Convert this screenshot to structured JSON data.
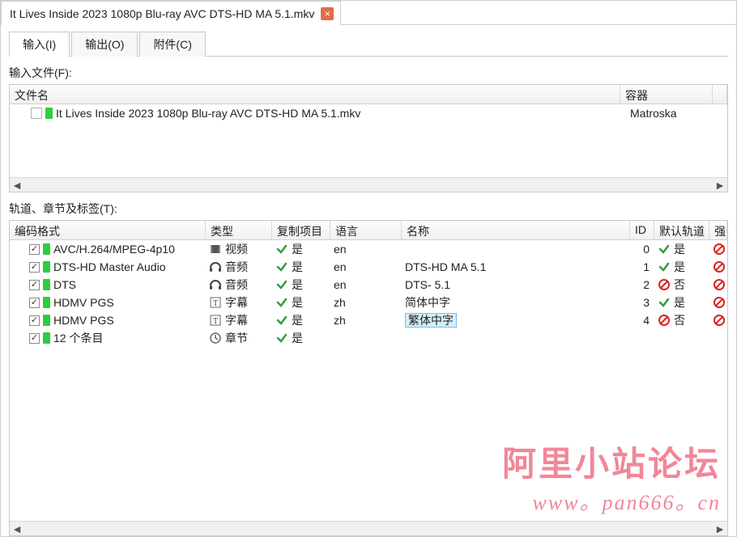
{
  "file_tab": {
    "title": "It Lives Inside 2023 1080p Blu-ray AVC DTS-HD MA 5.1.mkv"
  },
  "main_tabs": {
    "input": "输入(I)",
    "output": "输出(O)",
    "attachments": "附件(C)"
  },
  "input_files_label": "输入文件(F):",
  "files_header": {
    "name": "文件名",
    "container": "容器"
  },
  "file_row": {
    "name": "It Lives Inside 2023 1080p Blu-ray AVC DTS-HD MA 5.1.mkv",
    "container": "Matroska"
  },
  "tracks_label": "轨道、章节及标签(T):",
  "tracks_header": {
    "codec": "编码格式",
    "type": "类型",
    "copy": "复制项目",
    "lang": "语言",
    "name": "名称",
    "id": "ID",
    "default": "默认轨道",
    "forced_partial": "强"
  },
  "type_labels": {
    "video": "视频",
    "audio": "音频",
    "subtitle": "字幕",
    "chapter": "章节"
  },
  "yes": "是",
  "no": "否",
  "tracks": [
    {
      "checked": true,
      "swatch": "green",
      "codec": "AVC/H.264/MPEG-4p10",
      "type": "video",
      "copy": true,
      "lang": "en",
      "name": "",
      "id": "0",
      "default": true
    },
    {
      "checked": true,
      "swatch": "green",
      "codec": "DTS-HD Master Audio",
      "type": "audio",
      "copy": true,
      "lang": "en",
      "name": "DTS-HD MA 5.1",
      "id": "1",
      "default": true
    },
    {
      "checked": true,
      "swatch": "green",
      "codec": "DTS",
      "type": "audio",
      "copy": true,
      "lang": "en",
      "name": "DTS- 5.1",
      "id": "2",
      "default": false
    },
    {
      "checked": true,
      "swatch": "green",
      "codec": "HDMV PGS",
      "type": "subtitle",
      "copy": true,
      "lang": "zh",
      "name": "简体中字",
      "id": "3",
      "default": true
    },
    {
      "checked": true,
      "swatch": "green",
      "codec": "HDMV PGS",
      "type": "subtitle",
      "copy": true,
      "lang": "zh",
      "name": "繁体中字",
      "id": "4",
      "default": false,
      "selected": true
    },
    {
      "checked": true,
      "swatch": "green",
      "codec": "12 个条目",
      "type": "chapter",
      "copy": true,
      "lang": "",
      "name": "",
      "id": "",
      "default": null
    }
  ],
  "watermark": {
    "line1": "阿里小站论坛",
    "line2": "www。pan666。cn"
  }
}
